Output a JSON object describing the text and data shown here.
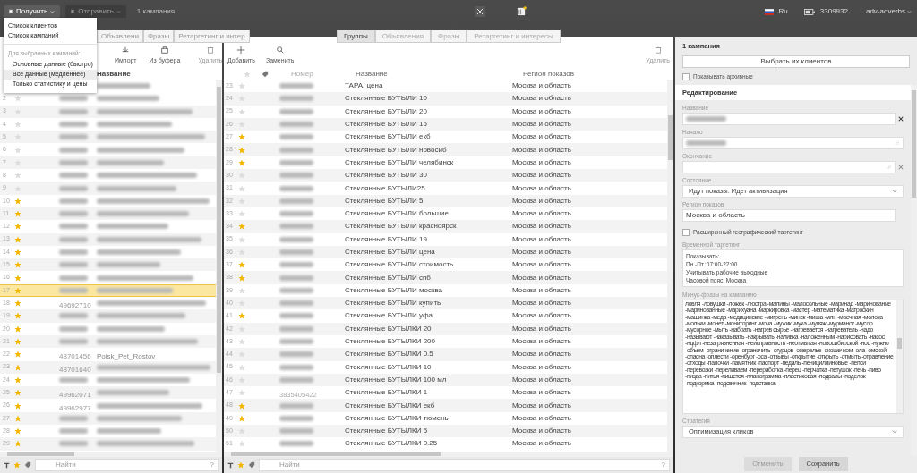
{
  "topbar": {
    "buttons": [
      {
        "label": "Получить",
        "active": true
      },
      {
        "label": "Отправить",
        "active": false
      }
    ],
    "selection_count": "1 кампания",
    "language": "Ru",
    "balance": "3309932",
    "user": "adv-adverbs"
  },
  "menu": {
    "items": [
      {
        "kind": "item",
        "label": "Список клиентов",
        "selected": false
      },
      {
        "kind": "item",
        "label": "Список кампаний",
        "selected": false
      },
      {
        "kind": "header",
        "label": "Для выбранных кампаний:"
      },
      {
        "kind": "subitem",
        "label": "Основные данные (быстро)",
        "selected": false
      },
      {
        "kind": "subitem",
        "label": "Все данные (медленнее)",
        "selected": true
      },
      {
        "kind": "subitem",
        "label": "Только статистику и цены",
        "selected": false
      }
    ]
  },
  "campaigns_panel": {
    "tabs": [
      {
        "label": "Объявлени",
        "selected": false
      },
      {
        "label": "Фразы",
        "selected": false
      },
      {
        "label": "Ретаргетинг и интер",
        "selected": false
      }
    ],
    "toolbar": [
      {
        "label": "Импорт",
        "disabled": false
      },
      {
        "label": "Из буфера",
        "disabled": false
      },
      {
        "label": "Удалить",
        "disabled": true
      }
    ],
    "columns": [
      "Название"
    ],
    "rows": [
      {
        "n": "2",
        "starred": false,
        "selected": false
      },
      {
        "n": "3",
        "starred": false,
        "selected": false
      },
      {
        "n": "4",
        "starred": false,
        "selected": false
      },
      {
        "n": "5",
        "starred": false,
        "selected": false
      },
      {
        "n": "6",
        "starred": false,
        "selected": false
      },
      {
        "n": "7",
        "starred": false,
        "selected": false
      },
      {
        "n": "8",
        "starred": false,
        "selected": false
      },
      {
        "n": "9",
        "starred": false,
        "selected": false
      },
      {
        "n": "10",
        "starred": true,
        "selected": false
      },
      {
        "n": "11",
        "starred": true,
        "selected": false
      },
      {
        "n": "12",
        "starred": true,
        "selected": false
      },
      {
        "n": "13",
        "starred": true,
        "selected": false
      },
      {
        "n": "14",
        "starred": true,
        "selected": false
      },
      {
        "n": "15",
        "starred": true,
        "selected": false
      },
      {
        "n": "16",
        "starred": true,
        "selected": false
      },
      {
        "n": "17",
        "starred": true,
        "selected": true
      },
      {
        "n": "18",
        "starred": true,
        "selected": false,
        "number": "49692710"
      },
      {
        "n": "19",
        "starred": true,
        "selected": false
      },
      {
        "n": "20",
        "starred": true,
        "selected": false
      },
      {
        "n": "21",
        "starred": true,
        "selected": false
      },
      {
        "n": "22",
        "starred": true,
        "selected": false,
        "number": "48701456",
        "name": "Poisk_Pet_Rostov"
      },
      {
        "n": "23",
        "starred": true,
        "selected": false,
        "number": "48701640"
      },
      {
        "n": "24",
        "starred": true,
        "selected": false
      },
      {
        "n": "25",
        "starred": true,
        "selected": false,
        "number": "49962071"
      },
      {
        "n": "26",
        "starred": true,
        "selected": false,
        "number": "49962977"
      },
      {
        "n": "27",
        "starred": true,
        "selected": false
      },
      {
        "n": "28",
        "starred": true,
        "selected": false
      },
      {
        "n": "29",
        "starred": true,
        "selected": false
      }
    ],
    "search": {
      "placeholder": "Найти",
      "help": "?"
    }
  },
  "groups_panel": {
    "tabs": [
      {
        "label": "Группы",
        "selected": true
      },
      {
        "label": "Объявления",
        "selected": false
      },
      {
        "label": "Фразы",
        "selected": false
      },
      {
        "label": "Ретаргетинг и интересы",
        "selected": false
      }
    ],
    "toolbar": [
      {
        "label": "Добавить",
        "disabled": false
      },
      {
        "label": "Заменить",
        "disabled": false
      },
      {
        "label": "Удалить",
        "disabled": true
      }
    ],
    "columns": [
      "Номер",
      "Название",
      "Регион показов"
    ],
    "rows": [
      {
        "n": "23",
        "starred": false,
        "name": "ТАРА. цена",
        "region": "Москва и область"
      },
      {
        "n": "24",
        "starred": false,
        "name": "Стеклянные БУТЫЛИ 10",
        "region": "Москва и область"
      },
      {
        "n": "25",
        "starred": false,
        "name": "Стеклянные БУТЫЛИ 20",
        "region": "Москва и область"
      },
      {
        "n": "26",
        "starred": false,
        "name": "Стеклянные БУТЫЛИ 15",
        "region": "Москва и область"
      },
      {
        "n": "27",
        "starred": true,
        "name": "Стеклянные БУТЫЛИ екб",
        "region": "Москва и область"
      },
      {
        "n": "28",
        "starred": true,
        "name": "Стеклянные БУТЫЛИ новосиб",
        "region": "Москва и область"
      },
      {
        "n": "29",
        "starred": true,
        "name": "Стеклянные БУТЫЛИ челябинск",
        "region": "Москва и область"
      },
      {
        "n": "30",
        "starred": false,
        "name": "Стеклянные БУТЫЛИ 30",
        "region": "Москва и область"
      },
      {
        "n": "31",
        "starred": false,
        "name": "Стеклянные БУТЫЛИ25",
        "region": "Москва и область"
      },
      {
        "n": "32",
        "starred": false,
        "name": "Стеклянные БУТЫЛИ 5",
        "region": "Москва и область"
      },
      {
        "n": "33",
        "starred": false,
        "name": "Стеклянные БУТЫЛИ большие",
        "region": "Москва и область"
      },
      {
        "n": "34",
        "starred": true,
        "name": "Стеклянные БУТЫЛИ красноярск",
        "region": "Москва и область"
      },
      {
        "n": "35",
        "starred": false,
        "name": "Стеклянные БУТЫЛИ 19",
        "region": "Москва и область"
      },
      {
        "n": "36",
        "starred": false,
        "name": "Стеклянные БУТЫЛИ цена",
        "region": "Москва и область"
      },
      {
        "n": "37",
        "starred": true,
        "name": "Стеклянные БУТЫЛИ стоимость",
        "region": "Москва и область"
      },
      {
        "n": "38",
        "starred": true,
        "name": "Стеклянные БУТЫЛИ спб",
        "region": "Москва и область"
      },
      {
        "n": "39",
        "starred": false,
        "name": "Стеклянные БУТЫЛИ москва",
        "region": "Москва и область"
      },
      {
        "n": "40",
        "starred": false,
        "name": "Стеклянные БУТЫЛИ купить",
        "region": "Москва и область"
      },
      {
        "n": "41",
        "starred": true,
        "name": "Стеклянные БУТЫЛИ уфа",
        "region": "Москва и область"
      },
      {
        "n": "42",
        "starred": false,
        "name": "Стеклянные БУТЫЛКИ 20",
        "region": "Москва и область"
      },
      {
        "n": "43",
        "starred": false,
        "name": "Стеклянные БУТЫЛКИ 200",
        "region": "Москва и область"
      },
      {
        "n": "44",
        "starred": false,
        "name": "Стеклянные БУТЫЛКИ 0.5",
        "region": "Москва и область"
      },
      {
        "n": "45",
        "starred": false,
        "name": "Стеклянные БУТЫЛКИ 10",
        "region": "Москва и область"
      },
      {
        "n": "46",
        "starred": false,
        "name": "Стеклянные БУТЫЛКИ 100 мл",
        "region": "Москва и область"
      },
      {
        "n": "47",
        "starred": false,
        "number": "3835405422",
        "name": "Стеклянные БУТЫЛКИ 1",
        "region": "Москва и область"
      },
      {
        "n": "48",
        "starred": true,
        "name": "Стеклянные БУТЫЛКИ екб",
        "region": "Москва и область"
      },
      {
        "n": "49",
        "starred": true,
        "name": "Стеклянные БУТЫЛКИ тюмень",
        "region": "Москва и область"
      },
      {
        "n": "50",
        "starred": false,
        "name": "Стеклянные БУТЫЛКИ 5",
        "region": "Москва и область"
      },
      {
        "n": "51",
        "starred": false,
        "name": "Стеклянные БУТЫЛКИ 0.25",
        "region": "Москва и область"
      }
    ],
    "search": {
      "placeholder": "Найти",
      "help": "?"
    }
  },
  "details": {
    "title": "1 кампания",
    "choose_button": "Выбрать их клиентов",
    "show_archived": {
      "label": "Показывать архивные",
      "checked": false
    },
    "section": "Редактирование",
    "fields": [
      {
        "kind": "text",
        "label": "Название",
        "redacted": true,
        "clear": true
      },
      {
        "kind": "date",
        "label": "Начало",
        "redacted": true,
        "clear": false
      },
      {
        "kind": "date",
        "label": "Окончание",
        "redacted": false,
        "clear": true
      },
      {
        "kind": "select",
        "label": "Состояние",
        "value": "Идут показы. Идет активизация"
      },
      {
        "kind": "text",
        "label": "Регион показов",
        "value": "Москва и область",
        "redacted": false
      },
      {
        "kind": "checkbox",
        "label": "Расширенный географический таргетинг",
        "checked": false
      },
      {
        "kind": "lines",
        "label": "Временной таргетинг",
        "lines": [
          "Показывать:",
          "Пн.-Пт.:07:00-22:00",
          "Учитывать рабочие выходные",
          "Часовой пояс: Москва"
        ]
      },
      {
        "kind": "textarea",
        "label": "Минус-фразы на кампанию",
        "value": "ловля -ловушки -ложек -люстра -малины -малосольные -маринад -маринование -маринованные -марихуана -маркировка -мастер -математика -матроскин -машинка -меда -медицинские -мигрень -минск -миша -млн -моечная -молока -мольки -монет -мониторинг -моча -мужик -мука -муляж -мурманск -мусор -мусорное -мыть -набрать -нагрев сырье -нагревается -нагреватель -надо -называют -наказывать -накрывать -наливка -наложенным -нарисовать -насос -ндфл -незагрязненная -неисправность -неотмытая -новосибирской -нос -нужно -объем -ограничение -ограничить -огурцов -ожерелье -окошечком -ола -омской -опасна -оплести -оренбург -оса -отзывы -открытие -открыть -отмыть -отравление -отходы -палочки -памятник -паспорт -педаль -пенициллиновые -пепси -перевозки -переливаем -переработка -перец -перчатка -петушок -печь -пиво -пизда -питья -пишется -планограмма -пластиковая -подвалы -поделок -подкормка -подсвечник -подставка -"
      },
      {
        "kind": "select",
        "label": "Стратегия",
        "value": "Оптимизация кликов"
      }
    ],
    "buttons": [
      {
        "label": "Отменить",
        "disabled": true
      },
      {
        "label": "Сохранить",
        "disabled": false
      }
    ]
  }
}
